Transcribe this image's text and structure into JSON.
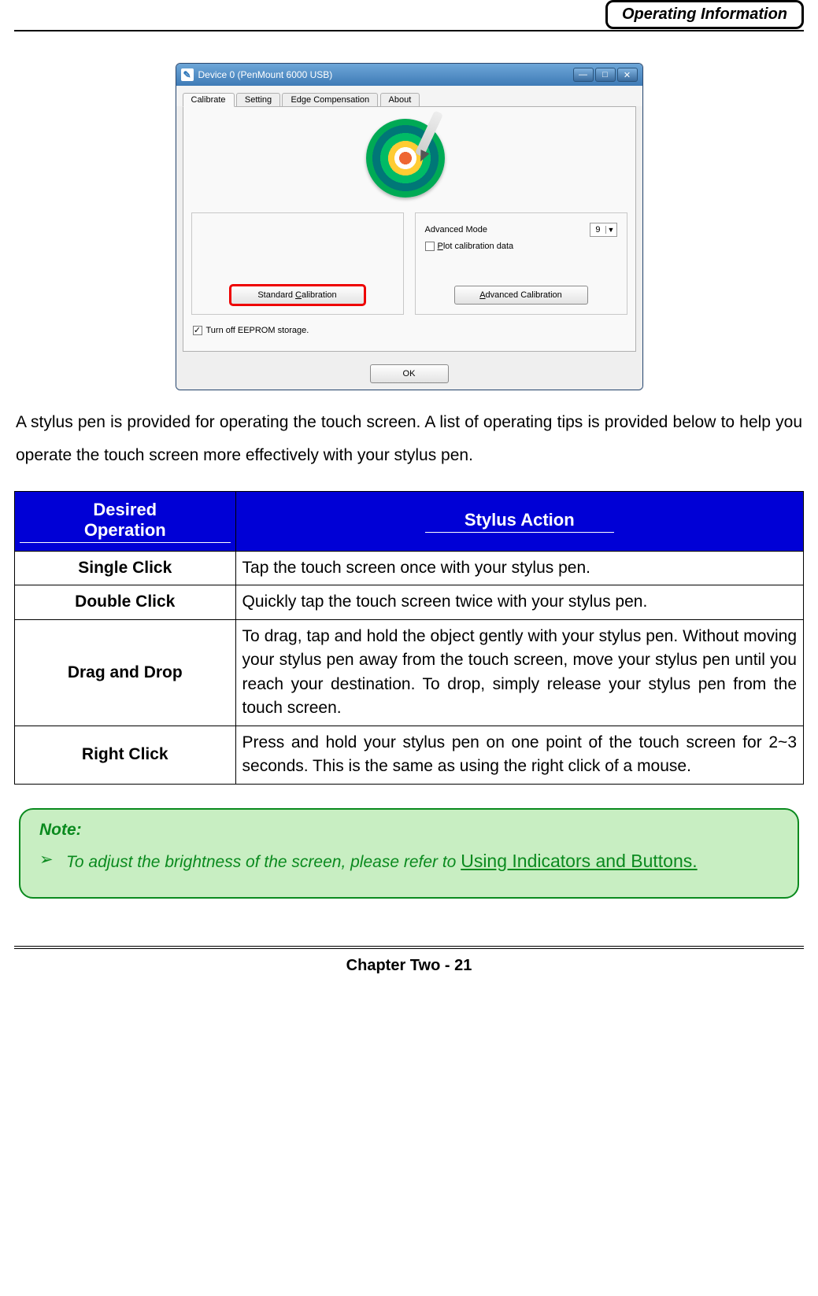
{
  "header": {
    "title": "Operating Information"
  },
  "window": {
    "title": "Device 0 (PenMount 6000 USB)",
    "app_icon_char": "✎",
    "tabs": [
      "Calibrate",
      "Setting",
      "Edge Compensation",
      "About"
    ],
    "left_group": {
      "button": "Standard Calibration"
    },
    "right_group": {
      "advanced_mode_label": "Advanced Mode",
      "advanced_mode_value": "9",
      "plot_label": "Plot calibration data",
      "button": "Advanced Calibration"
    },
    "eeprom_label": "Turn off EEPROM storage.",
    "ok_label": "OK"
  },
  "intro": "A stylus pen is provided for operating the touch screen. A list of operating tips is provided below to help you operate the touch screen more effectively with your stylus pen.",
  "table": {
    "headers": [
      "Desired Operation",
      "Stylus Action"
    ],
    "rows": [
      {
        "op": "Single Click",
        "action": "Tap the touch screen once with your stylus pen."
      },
      {
        "op": "Double Click",
        "action": "Quickly tap the touch screen twice with your stylus pen."
      },
      {
        "op": "Drag and Drop",
        "action": "To drag, tap and hold the object gently with your stylus pen. Without moving your stylus pen away from the touch screen, move your stylus pen until you reach your destination. To drop, simply release your stylus pen from the touch screen."
      },
      {
        "op": "Right Click",
        "action": "Press and hold your stylus pen on one point of the touch screen for 2~3 seconds. This is the same as using the right click of a mouse."
      }
    ]
  },
  "note": {
    "title": "Note:",
    "bullet": "➢",
    "text_prefix": "To adjust the brightness of the screen, please refer to ",
    "link": "Using Indicators and Buttons."
  },
  "footer": "Chapter Two - 21"
}
